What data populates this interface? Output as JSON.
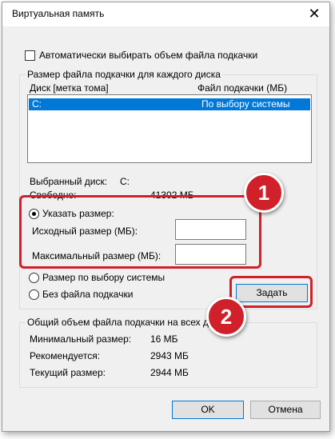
{
  "window": {
    "title": "Виртуальная память",
    "close_glyph": "✕"
  },
  "auto_manage": {
    "label": "Автоматически выбирать объем файла подкачки",
    "checked": false
  },
  "per_drive": {
    "group_title": "Размер файла подкачки для каждого диска",
    "columns": {
      "drive": "Диск [метка тома]",
      "paging_file": "Файл подкачки (МБ)"
    },
    "rows": [
      {
        "drive": "C:",
        "paging_file": "По выбору системы",
        "selected": true
      }
    ],
    "selected_drive_label": "Выбранный диск:",
    "selected_drive_value": "C:",
    "free_label": "Свободно:",
    "free_value": "41302 МБ"
  },
  "size_options": {
    "custom": {
      "label": "Указать размер:",
      "selected": true
    },
    "initial_label": "Исходный размер (МБ):",
    "initial_value": "",
    "maximum_label": "Максимальный размер (МБ):",
    "maximum_value": "",
    "system": {
      "label": "Размер по выбору системы",
      "selected": false
    },
    "none": {
      "label": "Без файла подкачки",
      "selected": false
    },
    "set_button": "Задать"
  },
  "totals": {
    "group_title": "Общий объем файла подкачки на всех дисках",
    "min_label": "Минимальный размер:",
    "min_value": "16 МБ",
    "recommended_label": "Рекомендуется:",
    "recommended_value": "2943 МБ",
    "current_label": "Текущий размер:",
    "current_value": "2944 МБ"
  },
  "footer": {
    "ok": "OK",
    "cancel": "Отмена"
  },
  "annotations": {
    "step1": "1",
    "step2": "2",
    "color": "#d0202a"
  }
}
